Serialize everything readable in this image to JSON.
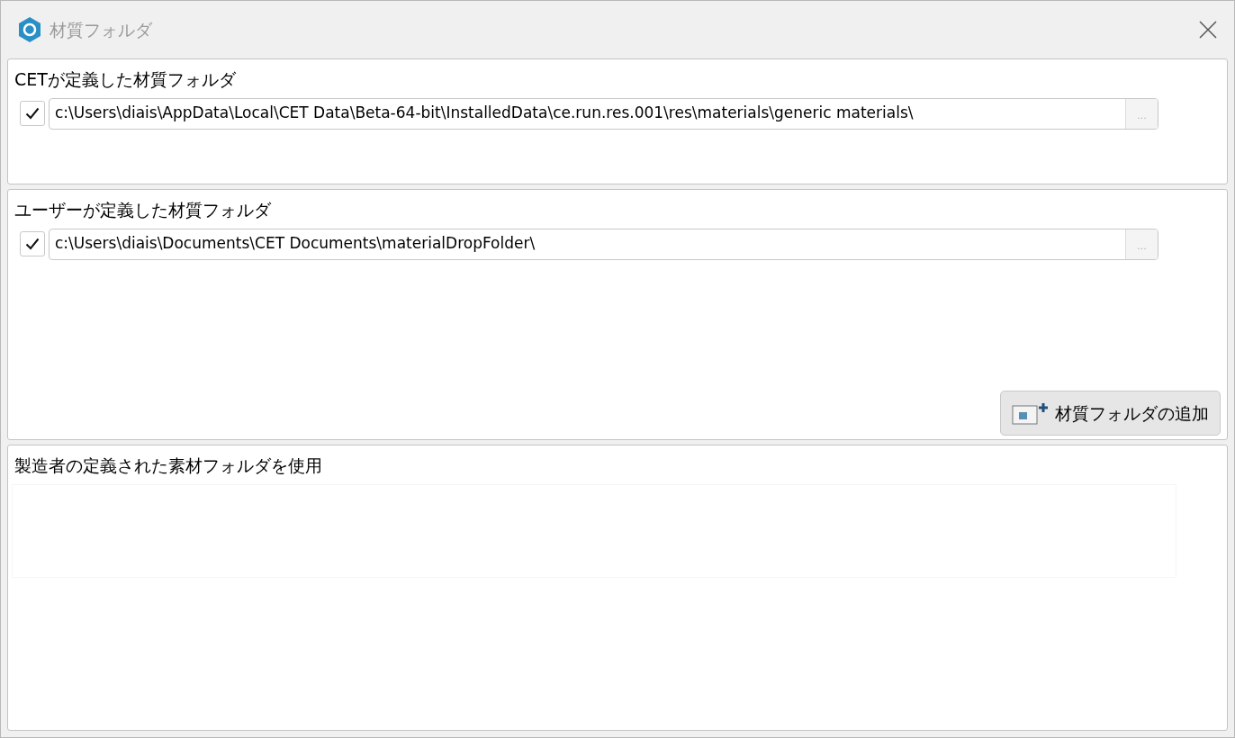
{
  "window": {
    "title": "材質フォルダ"
  },
  "cet_folders": {
    "title": "CETが定義した材質フォルダ",
    "folders": [
      {
        "checked": true,
        "path": "c:\\Users\\diais\\AppData\\Local\\CET Data\\Beta-64-bit\\InstalledData\\ce.run.res.001\\res\\materials\\generic materials\\",
        "browse_label": "..."
      }
    ]
  },
  "user_folders": {
    "title": "ユーザーが定義した材質フォルダ",
    "folders": [
      {
        "checked": true,
        "path": "c:\\Users\\diais\\Documents\\CET Documents\\materialDropFolder\\",
        "browse_label": "..."
      }
    ],
    "add_button": "材質フォルダの追加"
  },
  "manufacturer_folders": {
    "title": "製造者の定義された素材フォルダを使用"
  }
}
